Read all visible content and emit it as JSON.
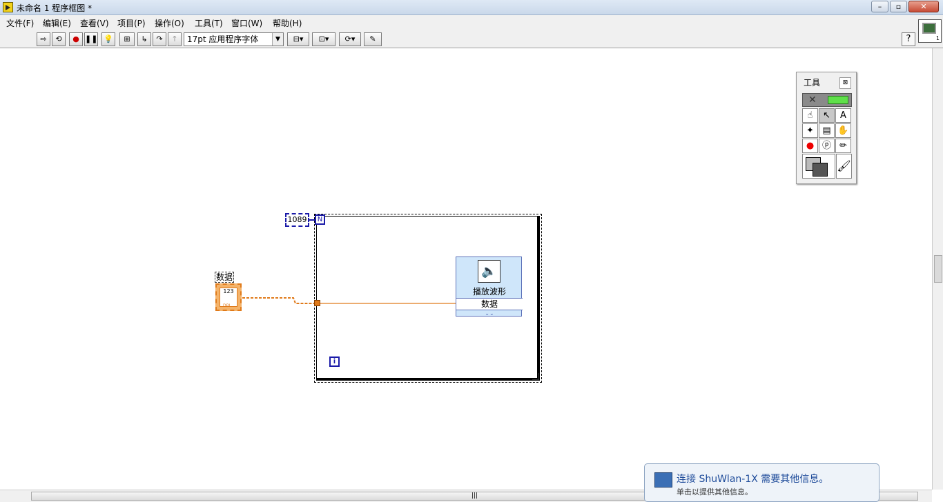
{
  "window": {
    "title": "未命名 1 程序框图 *"
  },
  "menu": [
    "文件(F)",
    "编辑(E)",
    "查看(V)",
    "项目(P)",
    "操作(O)",
    "工具(T)",
    "窗口(W)",
    "帮助(H)"
  ],
  "toolbar": {
    "font": "17pt 应用程序字体",
    "help": "?"
  },
  "tools_palette": {
    "title": "工具"
  },
  "diagram": {
    "loop_count": "1089",
    "n_terminal": "N",
    "i_terminal": "i",
    "control_label": "数据",
    "control_value": "123",
    "control_type": "DBL",
    "express_vi_name": "播放波形",
    "express_vi_input": "数据"
  },
  "notification": {
    "title": "连接 ShuWlan-1X 需要其他信息。",
    "subtitle": "单击以提供其他信息。"
  }
}
